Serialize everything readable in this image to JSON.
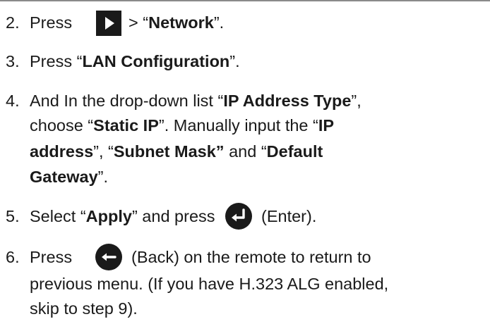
{
  "steps": [
    {
      "number": "2.",
      "prefix": "Press",
      "icon": "play-icon",
      "mid": "> “",
      "bold1": "Network",
      "end": "”."
    },
    {
      "number": "3.",
      "prefix": "Press “",
      "bold1": "LAN Configuration",
      "end": "”."
    },
    {
      "number": "4.",
      "l1_a": "And In the drop-down list “",
      "l1_b": "IP Address Type",
      "l1_c": "”,",
      "l2_a": "choose “",
      "l2_b": "Static IP",
      "l2_c": "”. Manually input the “",
      "l2_d": "IP",
      "l3_a": "address",
      "l3_b": "”, “",
      "l3_c": "Subnet Mask”",
      "l3_d": " and “",
      "l3_e": "Default",
      "l4_a": "Gateway",
      "l4_b": "”."
    },
    {
      "number": "5.",
      "a": "Select “",
      "b": "Apply",
      "c": "” and press",
      "icon": "enter-icon",
      "d": "(Enter)."
    },
    {
      "number": "6.",
      "a": "Press",
      "icon": "back-arrow-icon",
      "b": "(Back) on the remote to return to",
      "l2": "previous menu. (If you have H.323 ALG enabled,",
      "l3": "skip to step 9)."
    }
  ],
  "colors": {
    "icon_fill": "#1a1a1a",
    "icon_glyph": "#ffffff",
    "rule": "#8a8a8a"
  }
}
